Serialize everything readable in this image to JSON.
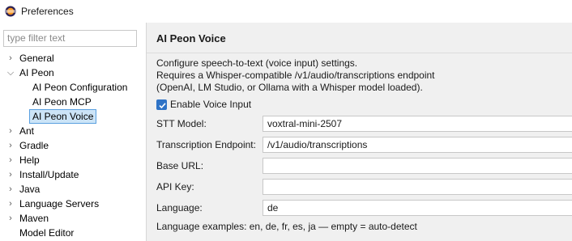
{
  "window": {
    "title": "Preferences",
    "icon": "eclipse-icon"
  },
  "sidebar": {
    "filter_placeholder": "type filter text",
    "items": [
      {
        "label": "General",
        "expander": "chevron-right"
      },
      {
        "label": "AI Peon",
        "expander": "chevron-down"
      },
      {
        "label": "AI Peon Configuration",
        "expander": ""
      },
      {
        "label": "AI Peon MCP",
        "expander": ""
      },
      {
        "label": "AI Peon Voice",
        "expander": "",
        "selected": true
      },
      {
        "label": "Ant",
        "expander": "chevron-right"
      },
      {
        "label": "Gradle",
        "expander": "chevron-right"
      },
      {
        "label": "Help",
        "expander": "chevron-right"
      },
      {
        "label": "Install/Update",
        "expander": "chevron-right"
      },
      {
        "label": "Java",
        "expander": "chevron-right"
      },
      {
        "label": "Language Servers",
        "expander": "chevron-right"
      },
      {
        "label": "Maven",
        "expander": "chevron-right"
      },
      {
        "label": "Model Editor",
        "expander": ""
      }
    ]
  },
  "page": {
    "title": "AI Peon Voice",
    "description": [
      "Configure speech-to-text (voice input) settings.",
      "Requires a Whisper-compatible /v1/audio/transcriptions endpoint",
      "(OpenAI, LM Studio, or Ollama with a Whisper model loaded)."
    ],
    "enable_voice": {
      "label": "Enable Voice Input",
      "checked": true
    },
    "fields": {
      "stt_model": {
        "label": "STT Model:",
        "value": "voxtral-mini-2507"
      },
      "endpoint": {
        "label": "Transcription Endpoint:",
        "value": "/v1/audio/transcriptions"
      },
      "base_url": {
        "label": "Base URL:",
        "value": ""
      },
      "api_key": {
        "label": "API Key:",
        "value": ""
      },
      "language": {
        "label": "Language:",
        "value": "de"
      }
    },
    "hint": "Language examples: en, de, fr, es, ja — empty = auto-detect"
  },
  "colors": {
    "accent": "#2f73c6",
    "selection_bg": "#cce4f7",
    "selection_border": "#5aa0e0",
    "panel_bg": "#f0f0f0"
  }
}
